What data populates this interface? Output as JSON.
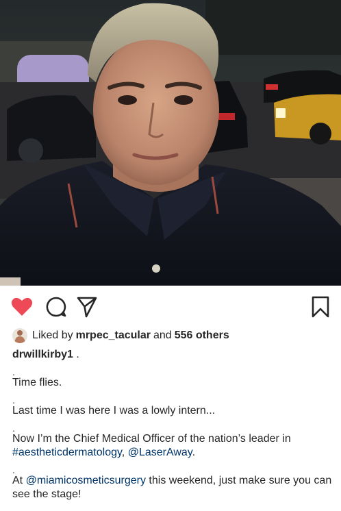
{
  "post": {
    "icons": {
      "like": "heart-filled-icon",
      "comment": "comment-bubble-icon",
      "share": "paper-plane-icon",
      "save": "bookmark-icon"
    },
    "colors": {
      "like_red": "#ed4956",
      "text": "#262626",
      "link": "#003569"
    }
  },
  "likes": {
    "prefix": "Liked by",
    "user": "mrpec_tacular",
    "and": "and",
    "count": "556 others"
  },
  "caption": {
    "username": "drwillkirby1",
    "after_username": " .",
    "dot": ".",
    "line1": "Time flies.",
    "line2": "Last time I was here I was a lowly intern...",
    "line3_text": "Now I’m the Chief Medical Officer of the nation’s leader in",
    "line3_tag": "#aestheticdermatology",
    "line3_comma": ",",
    "line3_mention": "@LaserAway",
    "line3_end": ".",
    "line4_prefix": "At",
    "line4_mention": "@miamicosmeticsurgery",
    "line4_text": " this weekend, just make sure you can see the stage!"
  }
}
